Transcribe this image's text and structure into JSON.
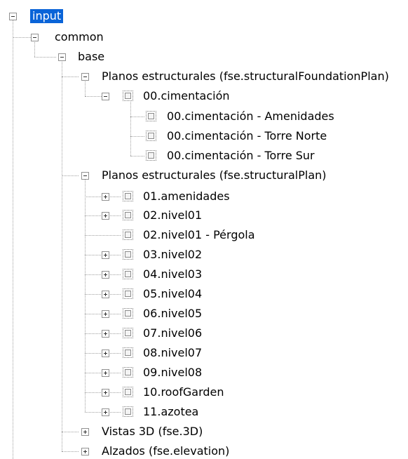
{
  "tree": {
    "root": "input",
    "common": "common",
    "base": "base",
    "foundation_group": "Planos estructurales (fse.structuralFoundationPlan)",
    "cimentacion": "00.cimentación",
    "cimentacion_children": [
      "00.cimentación - Amenidades",
      "00.cimentación - Torre Norte",
      "00.cimentación - Torre Sur"
    ],
    "plan_group": "Planos estructurales (fse.structuralPlan)",
    "plan_children": [
      {
        "label": "01.amenidades",
        "expandable": true
      },
      {
        "label": "02.nivel01",
        "expandable": true
      },
      {
        "label": "02.nivel01 - Pérgola",
        "expandable": false
      },
      {
        "label": "03.nivel02",
        "expandable": true
      },
      {
        "label": "04.nivel03",
        "expandable": true
      },
      {
        "label": "05.nivel04",
        "expandable": true
      },
      {
        "label": "06.nivel05",
        "expandable": true
      },
      {
        "label": "07.nivel06",
        "expandable": true
      },
      {
        "label": "08.nivel07",
        "expandable": true
      },
      {
        "label": "09.nivel08",
        "expandable": true
      },
      {
        "label": "10.roofGarden",
        "expandable": true
      },
      {
        "label": "11.azotea",
        "expandable": true
      }
    ],
    "vistas_3d": "Vistas 3D (fse.3D)",
    "alzados": "Alzados (fse.elevation)"
  },
  "colors": {
    "selection_bg": "#0a64d8",
    "selection_fg": "#ffffff",
    "tree_line": "#a0a0a0"
  }
}
